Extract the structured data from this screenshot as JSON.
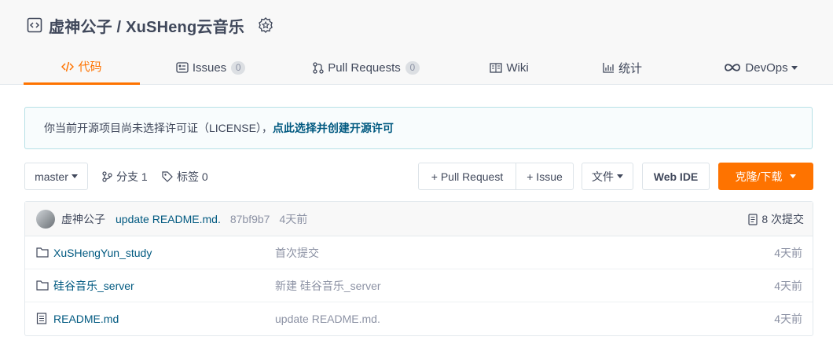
{
  "repo": {
    "title": "虚神公子 / XuSHeng云音乐"
  },
  "tabs": [
    {
      "label": "代码",
      "icon": "code-icon",
      "active": true
    },
    {
      "label": "Issues",
      "icon": "issues-icon",
      "count": "0"
    },
    {
      "label": "Pull Requests",
      "icon": "pull-request-icon",
      "count": "0"
    },
    {
      "label": "Wiki",
      "icon": "wiki-icon"
    },
    {
      "label": "统计",
      "icon": "stats-icon"
    },
    {
      "label": "DevOps",
      "icon": "devops-icon"
    }
  ],
  "notice": {
    "text": "你当前开源项目尚未选择许可证（LICENSE），",
    "link": "点此选择并创建开源许可"
  },
  "toolbar": {
    "branch": "master",
    "branches": "分支 1",
    "tags": "标签 0",
    "new_pr": "+ Pull Request",
    "new_issue": "+ Issue",
    "file_menu": "文件",
    "web_ide": "Web IDE",
    "clone": "克隆/下载"
  },
  "last_commit": {
    "author": "虚神公子",
    "message": "update README.md.",
    "hash": "87bf9b7",
    "time": "4天前",
    "count": "8 次提交"
  },
  "files": [
    {
      "name": "XuSHengYun_study",
      "type": "folder",
      "message": "首次提交",
      "time": "4天前"
    },
    {
      "name": "硅谷音乐_server",
      "type": "folder",
      "message": "新建 硅谷音乐_server",
      "time": "4天前"
    },
    {
      "name": "README.md",
      "type": "file",
      "message": "update README.md.",
      "time": "4天前"
    }
  ],
  "colors": {
    "accent": "#fe7300",
    "link": "#005980",
    "muted": "#8c92a4"
  }
}
